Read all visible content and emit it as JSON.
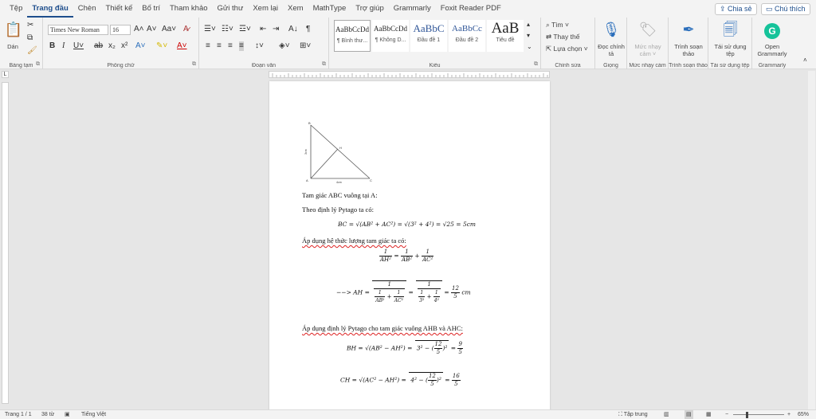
{
  "menu": {
    "tabs": [
      "Tệp",
      "Trang đầu",
      "Chèn",
      "Thiết kế",
      "Bố trí",
      "Tham khảo",
      "Gửi thư",
      "Xem lại",
      "Xem",
      "MathType",
      "Trợ giúp",
      "Grammarly",
      "Foxit Reader PDF"
    ],
    "active_tab": "Trang đầu",
    "share_label": "Chia sẻ",
    "comments_label": "Chú thích"
  },
  "ribbon": {
    "clipboard": {
      "paste_label": "Dán",
      "group_label": "Bảng tạm"
    },
    "font": {
      "font_name": "Times New Roman",
      "font_size": "16",
      "group_label": "Phông chữ",
      "case_label": "Aa"
    },
    "paragraph": {
      "group_label": "Đoạn văn"
    },
    "styles": {
      "group_label": "Kiểu",
      "items": [
        {
          "preview": "AaBbCcDd",
          "name": "¶ Bình thư..."
        },
        {
          "preview": "AaBbCcDd",
          "name": "¶ Không D..."
        },
        {
          "preview": "AaBbC",
          "name": "Đầu đề 1"
        },
        {
          "preview": "AaBbCc",
          "name": "Đầu đề 2"
        },
        {
          "preview": "AaB",
          "name": "Tiêu đề"
        }
      ]
    },
    "editing": {
      "find": "Tìm",
      "replace": "Thay thế",
      "select": "Lựa chọn",
      "group_label": "Chỉnh sửa"
    },
    "voice": {
      "dictate": "Đọc chính tả",
      "group_label": "Giọng"
    },
    "sensitivity": {
      "label": "Mức nhạy cảm",
      "group_label": "Mức nhạy cảm"
    },
    "editor": {
      "label": "Trình soạn thảo",
      "group_label": "Trình soạn thảo"
    },
    "reuse": {
      "label": "Tái sử dụng tệp",
      "group_label": "Tái sử dụng tệp"
    },
    "grammarly": {
      "label": "Open Grammarly",
      "group_label": "Grammarly"
    }
  },
  "document": {
    "figure": {
      "vertex_b": "B",
      "vertex_a": "A",
      "vertex_c": "C",
      "vertex_h": "H",
      "side_ab": "3cm",
      "side_ac": "4cm"
    },
    "line1": "Tam giác ABC vuông tại A:",
    "line2": "Theo định lý Pytago ta có:",
    "eq1": "BC = √(AB² + AC²) = √(3² + 4²) = √25 = 5cm",
    "line3": "Áp dụng hệ thức lượng tam giác ta có:",
    "eq2": "1/AH² = 1/AB² + 1/AC²",
    "eq3_prefix": "−−> AH =",
    "eq3_suffix": "cm",
    "eq3_result_num": "12",
    "eq3_result_den": "5",
    "line4": "Áp dụng định lý Pytago cho tam giác vuông AHB và AHC:",
    "eq4_lhs": "BH = √(AB² − AH²) =",
    "eq4_result_num": "9",
    "eq4_result_den": "5",
    "eq5_lhs": "CH = √(AC² − AH²) =",
    "eq5_result_num": "16",
    "eq5_result_den": "5"
  },
  "status": {
    "page": "Trang 1 / 1",
    "words": "38 từ",
    "language": "Tiếng Việt",
    "focus": "Tập trung",
    "zoom": "65%"
  }
}
